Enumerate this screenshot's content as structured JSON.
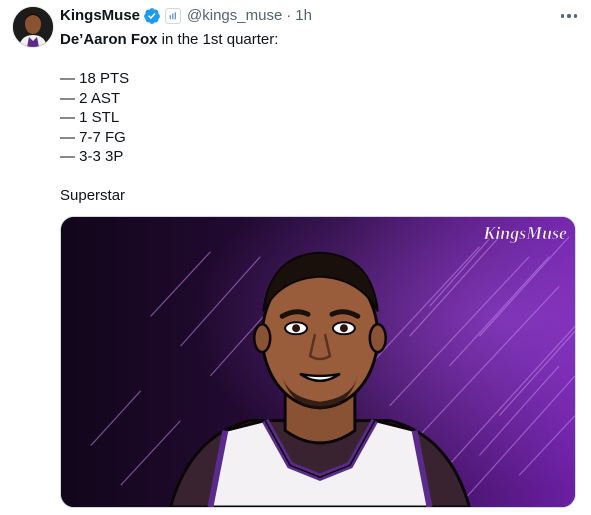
{
  "tweet": {
    "display_name": "KingsMuse",
    "handle": "@kings_muse",
    "separator": "·",
    "time": "1h",
    "verified_icon": "verified-check-icon",
    "affiliate_icon": "affiliate-badge-icon",
    "more_icon": "more-options-icon",
    "text": {
      "player": "De’Aaron Fox",
      "intro_rest": " in the 1st quarter:",
      "stats": [
        "— 18 PTS",
        "— 2 AST",
        "— 1 STL",
        "— 7-7 FG",
        "— 3-3 3P"
      ],
      "closing": "Superstar"
    },
    "media": {
      "watermark": "KingsMuse",
      "description_icon": "player-illustration"
    }
  },
  "colors": {
    "verified_blue": "#1d9bf0",
    "handle_gray": "#536471",
    "media_purple": "#5a1a86",
    "media_dark": "#1a0a22"
  }
}
